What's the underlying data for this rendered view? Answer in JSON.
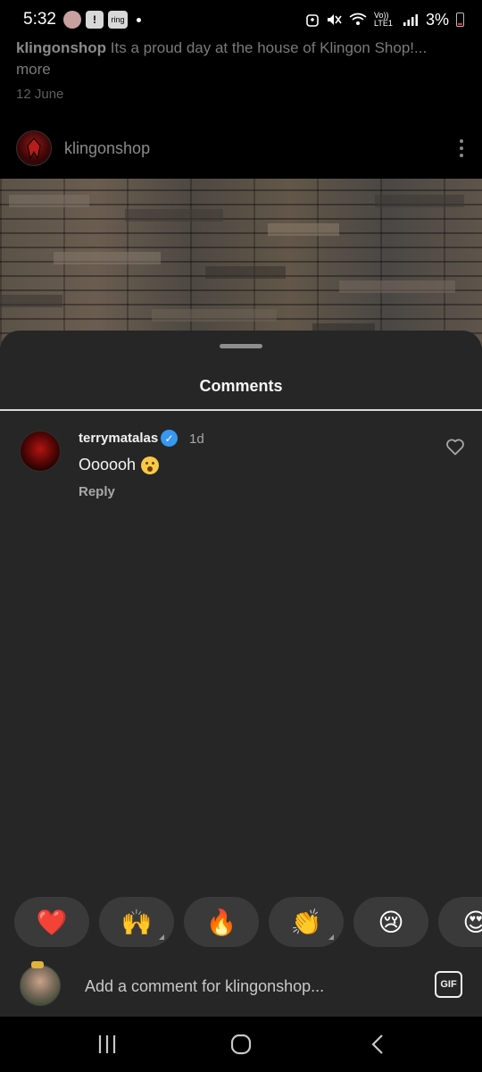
{
  "status_bar": {
    "time": "5:32",
    "notif_icon_1": "!",
    "notif_icon_2": "ring",
    "network": "Vo)) LTE1",
    "battery": "3%"
  },
  "post": {
    "caption_user": "klingonshop",
    "caption_text": " Its a proud day at the house of Klingon Shop!...",
    "caption_more": "more",
    "date": "12 June",
    "author": "klingonshop"
  },
  "comments_sheet": {
    "title": "Comments",
    "comments": [
      {
        "username": "terrymatalas",
        "time": "1d",
        "text": "Oooooh",
        "reply_label": "Reply"
      }
    ],
    "reactions": [
      "❤️",
      "🙌",
      "🔥",
      "👏",
      "😢",
      "😍"
    ],
    "composer": {
      "placeholder": "Add a comment for klingonshop...",
      "gif_label": "GIF"
    }
  },
  "icons": {
    "verified": "verified-badge-icon",
    "like": "heart-outline-icon",
    "more": "kebab-menu-icon",
    "nav": [
      "recents-icon",
      "home-icon",
      "back-icon"
    ]
  },
  "colors": {
    "sheet_bg": "#262626",
    "verified": "#3897f0",
    "reaction_bg": "#3a3a3a"
  }
}
